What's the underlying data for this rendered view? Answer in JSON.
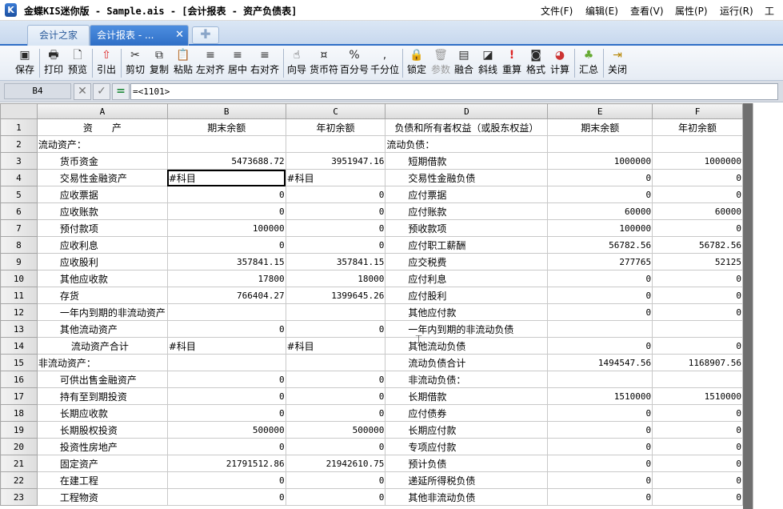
{
  "window": {
    "logo": "K",
    "title": "金蝶KIS迷你版 - Sample.ais - [会计报表 - 资产负债表]",
    "menu": [
      "文件(F)",
      "编辑(E)",
      "查看(V)",
      "属性(P)",
      "运行(R)",
      "工"
    ]
  },
  "tabs": {
    "home_label": "会计之家",
    "report_label": "会计报表 - ...",
    "close_glyph": "✕",
    "add_glyph": "✚"
  },
  "toolbar": {
    "items": [
      {
        "label": "保存",
        "icon": "save-icon",
        "glyph": "▣"
      },
      {
        "label": "打印",
        "icon": "print-icon",
        "glyph": "🖶"
      },
      {
        "label": "预览",
        "icon": "preview-icon",
        "glyph": "🗋"
      },
      {
        "label": "引出",
        "icon": "export-icon",
        "glyph": "⇧"
      },
      {
        "label": "剪切",
        "icon": "cut-icon",
        "glyph": "✂"
      },
      {
        "label": "复制",
        "icon": "copy-icon",
        "glyph": "⧉"
      },
      {
        "label": "粘贴",
        "icon": "paste-icon",
        "glyph": "📋"
      },
      {
        "label": "左对齐",
        "icon": "align-left-icon",
        "glyph": "≡"
      },
      {
        "label": "居中",
        "icon": "align-center-icon",
        "glyph": "≡"
      },
      {
        "label": "右对齐",
        "icon": "align-right-icon",
        "glyph": "≡"
      },
      {
        "label": "向导",
        "icon": "wizard-icon",
        "glyph": "☝"
      },
      {
        "label": "货币符",
        "icon": "currency-icon",
        "glyph": "¤"
      },
      {
        "label": "百分号",
        "icon": "percent-icon",
        "glyph": "%"
      },
      {
        "label": "千分位",
        "icon": "thousands-icon",
        "glyph": ","
      },
      {
        "label": "锁定",
        "icon": "lock-icon",
        "glyph": "🔒"
      },
      {
        "label": "参数",
        "icon": "trash-icon",
        "glyph": "🗑"
      },
      {
        "label": "融合",
        "icon": "merge-icon",
        "glyph": "▤"
      },
      {
        "label": "斜线",
        "icon": "diagonal-icon",
        "glyph": "◪"
      },
      {
        "label": "重算",
        "icon": "recalc-icon",
        "glyph": "!"
      },
      {
        "label": "格式",
        "icon": "format-icon",
        "glyph": "◙"
      },
      {
        "label": "计算",
        "icon": "calculate-icon",
        "glyph": "◕"
      },
      {
        "label": "汇总",
        "icon": "summary-icon",
        "glyph": "♣"
      },
      {
        "label": "关闭",
        "icon": "close-door-icon",
        "glyph": "⇥"
      }
    ]
  },
  "formula": {
    "cell_ref": "B4",
    "cancel_glyph": "✕",
    "accept_glyph": "✓",
    "formula_glyph": "=",
    "value": "=<1101>"
  },
  "grid": {
    "columns": [
      "",
      "A",
      "B",
      "C",
      "D",
      "E",
      "F"
    ],
    "rows": [
      {
        "n": "1",
        "a": "资　　产",
        "b": "期末余额",
        "c": "年初余额",
        "d": "负债和所有者权益（或股东权益）",
        "e": "期末余额",
        "f": "年初余额"
      },
      {
        "n": "2",
        "a": "流动资产：",
        "b": "",
        "c": "",
        "d": "流动负债：",
        "e": "",
        "f": ""
      },
      {
        "n": "3",
        "a": "货币资金",
        "b": "5473688.72",
        "c": "3951947.16",
        "d": "短期借款",
        "e": "1000000",
        "f": "1000000"
      },
      {
        "n": "4",
        "a": "交易性金融资产",
        "b": "#科目",
        "c": "#科目",
        "d": "交易性金融负债",
        "e": "0",
        "f": "0"
      },
      {
        "n": "5",
        "a": "应收票据",
        "b": "0",
        "c": "0",
        "d": "应付票据",
        "e": "0",
        "f": "0"
      },
      {
        "n": "6",
        "a": "应收账款",
        "b": "0",
        "c": "0",
        "d": "应付账款",
        "e": "60000",
        "f": "60000"
      },
      {
        "n": "7",
        "a": "预付款项",
        "b": "100000",
        "c": "0",
        "d": "预收款项",
        "e": "100000",
        "f": "0"
      },
      {
        "n": "8",
        "a": "应收利息",
        "b": "0",
        "c": "0",
        "d": "应付职工薪酬",
        "e": "56782.56",
        "f": "56782.56"
      },
      {
        "n": "9",
        "a": "应收股利",
        "b": "357841.15",
        "c": "357841.15",
        "d": "应交税费",
        "e": "277765",
        "f": "52125"
      },
      {
        "n": "10",
        "a": "其他应收款",
        "b": "17800",
        "c": "18000",
        "d": "应付利息",
        "e": "0",
        "f": "0"
      },
      {
        "n": "11",
        "a": "存货",
        "b": "766404.27",
        "c": "1399645.26",
        "d": "应付股利",
        "e": "0",
        "f": "0"
      },
      {
        "n": "12",
        "a": "一年内到期的非流动资产",
        "b": "",
        "c": "",
        "d": "其他应付款",
        "e": "0",
        "f": "0"
      },
      {
        "n": "13",
        "a": "其他流动资产",
        "b": "0",
        "c": "0",
        "d": "一年内到期的非流动负债",
        "e": "",
        "f": ""
      },
      {
        "n": "14",
        "a": "流动资产合计",
        "b": "#科目",
        "c": "#科目",
        "d": "其他流动负债",
        "e": "0",
        "f": "0"
      },
      {
        "n": "15",
        "a": "非流动资产：",
        "b": "",
        "c": "",
        "d": "流动负债合计",
        "e": "1494547.56",
        "f": "1168907.56"
      },
      {
        "n": "16",
        "a": "可供出售金融资产",
        "b": "0",
        "c": "0",
        "d": "非流动负债：",
        "e": "",
        "f": ""
      },
      {
        "n": "17",
        "a": "持有至到期投资",
        "b": "0",
        "c": "0",
        "d": "长期借款",
        "e": "1510000",
        "f": "1510000"
      },
      {
        "n": "18",
        "a": "长期应收款",
        "b": "0",
        "c": "0",
        "d": "应付债券",
        "e": "0",
        "f": "0"
      },
      {
        "n": "19",
        "a": "长期股权投资",
        "b": "500000",
        "c": "500000",
        "d": "长期应付款",
        "e": "0",
        "f": "0"
      },
      {
        "n": "20",
        "a": "投资性房地产",
        "b": "0",
        "c": "0",
        "d": "专项应付款",
        "e": "0",
        "f": "0"
      },
      {
        "n": "21",
        "a": "固定资产",
        "b": "21791512.86",
        "c": "21942610.75",
        "d": "预计负债",
        "e": "0",
        "f": "0"
      },
      {
        "n": "22",
        "a": "在建工程",
        "b": "0",
        "c": "0",
        "d": "递延所得税负债",
        "e": "0",
        "f": "0"
      },
      {
        "n": "23",
        "a": "工程物资",
        "b": "0",
        "c": "0",
        "d": "其他非流动负债",
        "e": "0",
        "f": "0"
      }
    ]
  }
}
